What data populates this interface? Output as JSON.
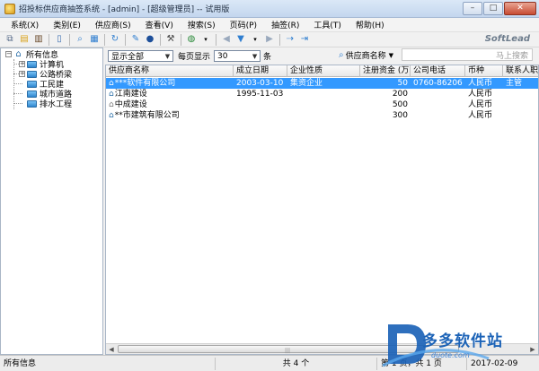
{
  "window": {
    "title": "招投标供应商抽签系统 - [admin] - [超级管理员] -- 试用版",
    "buttons": {
      "minimize": "–",
      "maximize": "□",
      "close": "✕"
    }
  },
  "menu": [
    {
      "label": "系统(X)"
    },
    {
      "label": "类别(E)"
    },
    {
      "label": "供应商(S)"
    },
    {
      "label": "查看(V)"
    },
    {
      "label": "搜索(S)"
    },
    {
      "label": "页码(P)"
    },
    {
      "label": "抽签(R)"
    },
    {
      "label": "工具(T)"
    },
    {
      "label": "帮助(H)"
    }
  ],
  "toolbar": {
    "brand": "SoftLead"
  },
  "tree": {
    "root": "所有信息",
    "items": [
      {
        "label": "计算机",
        "expandable": true
      },
      {
        "label": "公路桥梁",
        "expandable": true
      },
      {
        "label": "工民建",
        "expandable": false
      },
      {
        "label": "城市道路",
        "expandable": false
      },
      {
        "label": "排水工程",
        "expandable": false
      }
    ]
  },
  "filter": {
    "display_value": "显示全部",
    "per_page_label": "每页显示",
    "per_page_value": "30",
    "per_page_unit": "条",
    "search_field": "供应商名称",
    "search_placeholder": "马上搜索"
  },
  "table": {
    "columns": [
      "供应商名称",
      "成立日期",
      "企业性质",
      "注册资金 (万)",
      "公司电话",
      "币种",
      "联系人职"
    ],
    "rows": [
      {
        "name": "***软件有限公司",
        "date": "2003-03-10",
        "nature": "集资企业",
        "capital": "50",
        "phone": "0760-86206",
        "currency": "人民币",
        "contact": "主管",
        "selected": true
      },
      {
        "name": "江南建设",
        "date": "1995-11-03",
        "nature": "",
        "capital": "200",
        "phone": "",
        "currency": "人民币",
        "contact": "",
        "selected": false
      },
      {
        "name": "中成建设",
        "date": "",
        "nature": "",
        "capital": "500",
        "phone": "",
        "currency": "人民币",
        "contact": "",
        "selected": false
      },
      {
        "name": "**市建筑有限公司",
        "date": "",
        "nature": "",
        "capital": "300",
        "phone": "",
        "currency": "人民币",
        "contact": "",
        "selected": false
      }
    ]
  },
  "status": {
    "left": "所有信息",
    "count": "共 4 个",
    "pages": "第 1 页，共 1 页",
    "date": "2017-02-09"
  },
  "watermark": {
    "text": "多多软件站",
    "url": "duote.com"
  },
  "colors": {
    "selection": "#3399ff",
    "titlebar": "#c3d6ee",
    "watermark": "#1c63b7"
  }
}
